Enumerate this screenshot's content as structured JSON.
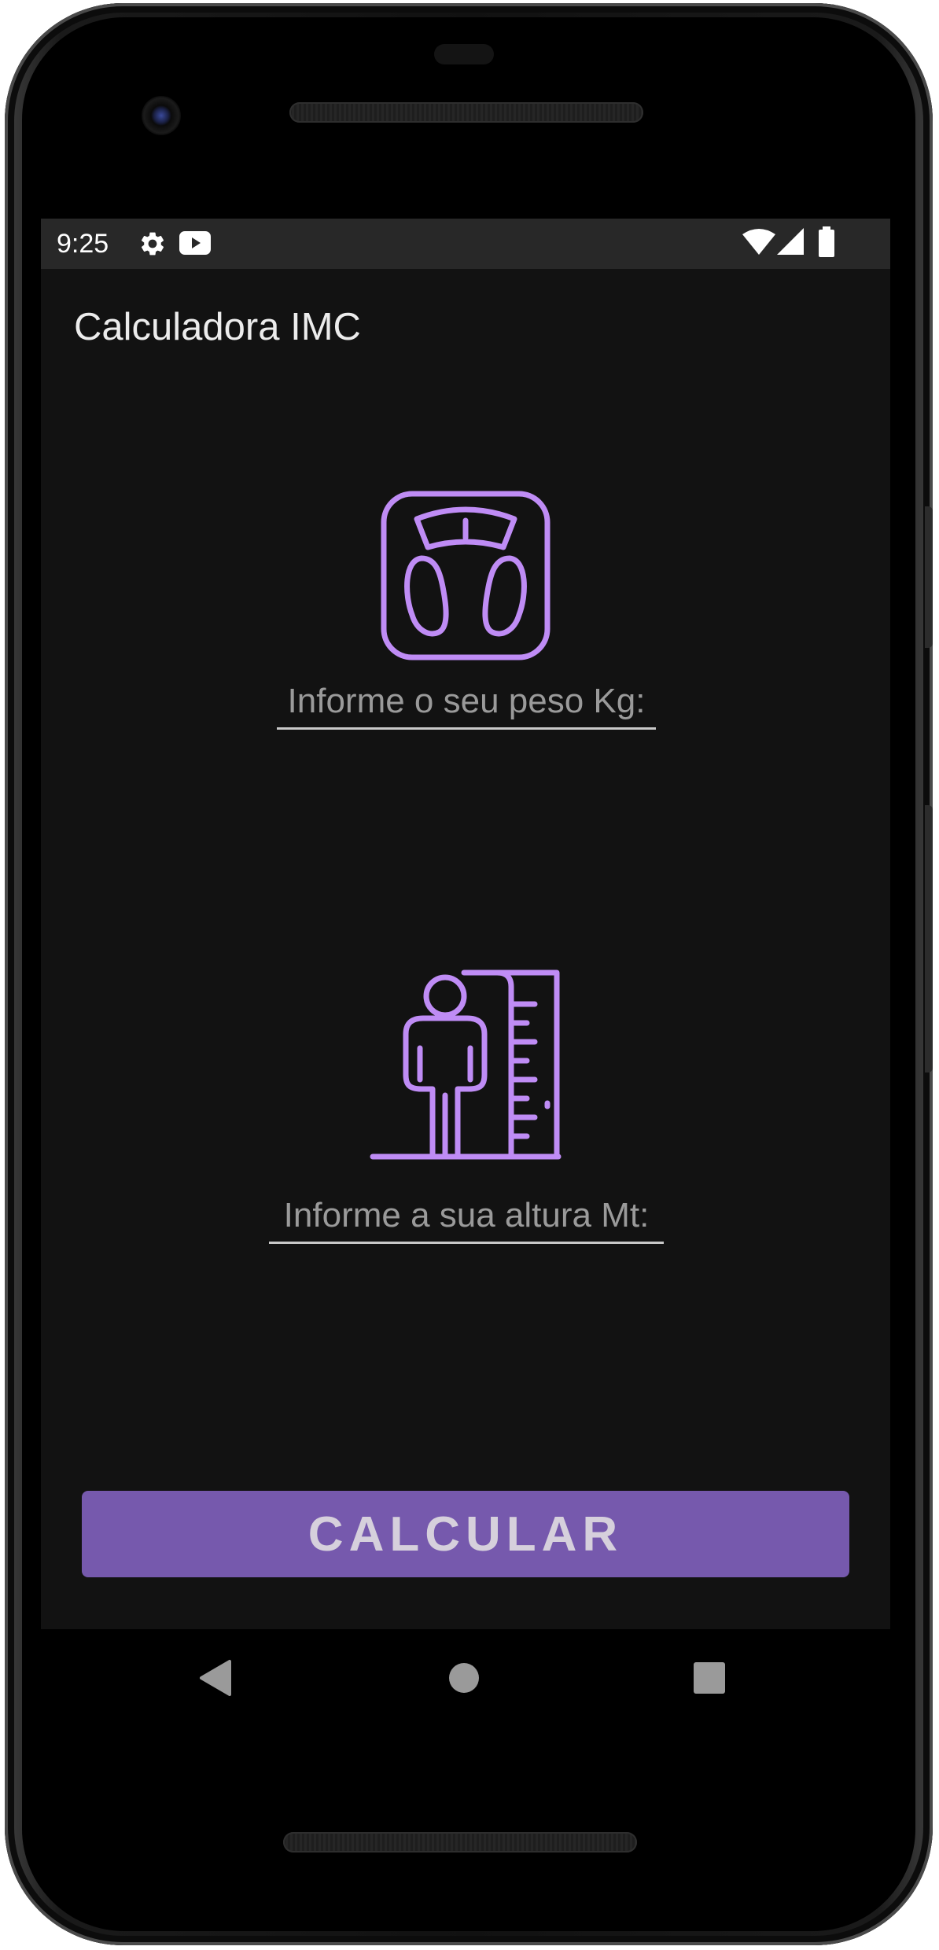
{
  "status_bar": {
    "time": "9:25",
    "left_icons": [
      "gear-icon",
      "youtube-icon"
    ],
    "right_icons": [
      "wifi-icon",
      "signal-icon",
      "battery-icon"
    ]
  },
  "app": {
    "title": "Calculadora IMC"
  },
  "weight": {
    "icon": "scale-icon",
    "placeholder": "Informe o seu peso Kg:",
    "value": ""
  },
  "height": {
    "icon": "height-measure-icon",
    "placeholder": "Informe a sua altura Mt:",
    "value": ""
  },
  "calculate_button": {
    "label": "CALCULAR"
  },
  "nav_bar": {
    "icons": [
      "back-icon",
      "home-icon",
      "recents-icon"
    ]
  },
  "colors": {
    "screen_background": "#121212",
    "status_bar": "#282828",
    "accent_purple": "#bf8cf5",
    "button_purple": "#7659ad",
    "button_text": "#d6d0dc"
  }
}
